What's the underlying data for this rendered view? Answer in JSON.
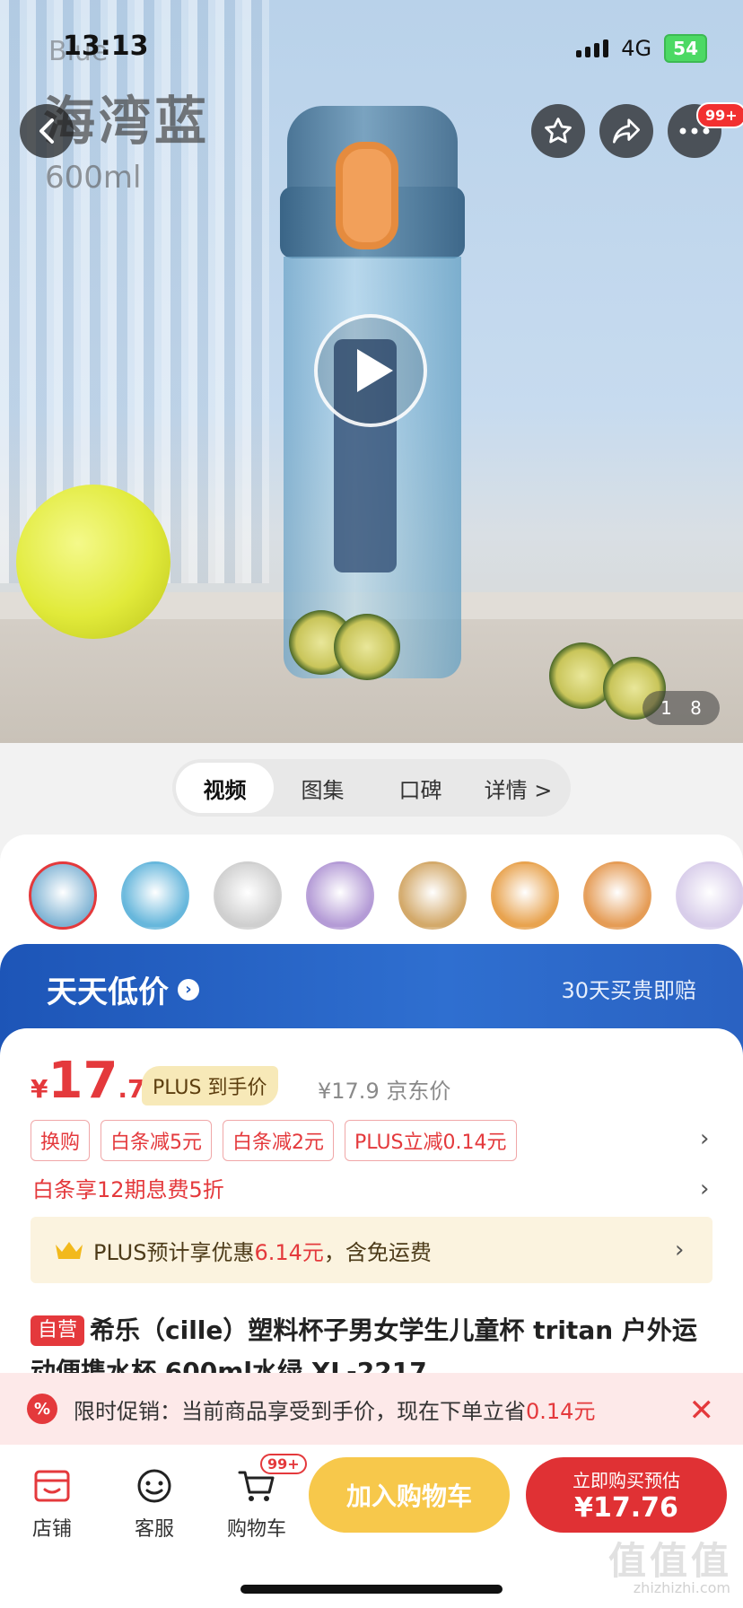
{
  "status_bar": {
    "time": "13:13",
    "network": "4G",
    "battery": "54"
  },
  "hero": {
    "overlay_title": "海湾蓝",
    "overlay_sub": "600ml",
    "overlay_top": "Blue",
    "pager_current": "1",
    "pager_total": "8",
    "cart_badge_top": "99+"
  },
  "tabs": [
    {
      "label": "视频",
      "active": true
    },
    {
      "label": "图集",
      "active": false
    },
    {
      "label": "口碑",
      "active": false
    },
    {
      "label": "详情 >",
      "active": false
    }
  ],
  "thumb_colors": [
    "#7fb3d4",
    "#67b7dc",
    "#cfcfcf",
    "#b49bd6",
    "#d3a96a",
    "#e8a34f",
    "#e59c56",
    "#d8cdea"
  ],
  "banner": {
    "title": "天天低价",
    "right": "30天买贵即赔"
  },
  "price": {
    "currency": "¥",
    "integer": "17",
    "decimal": ".76",
    "plus_tag": "PLUS 到手价",
    "jd_price": "¥17.9 京东价"
  },
  "promos": [
    "换购",
    "白条减5元",
    "白条减2元",
    "PLUS立减0.14元"
  ],
  "installment": "白条享12期息费5折",
  "plus_bar": {
    "prefix": "PLUS预计享优惠",
    "amount": "6.14元",
    "suffix": "，含免运费"
  },
  "product": {
    "tag": "自营",
    "title": "希乐（cille）塑料杯子男女学生儿童杯 tritan 户外运动便携水杯 600ml水绿 XL-2217"
  },
  "toast": {
    "text": "限时促销：当前商品享受到手价，现在下单立省",
    "amount": "0.14元",
    "icon": "%"
  },
  "bottom": {
    "store": "店铺",
    "service": "客服",
    "cart": "购物车",
    "cart_badge": "99+",
    "add_cart": "加入购物车",
    "buy_line1": "立即购买预估",
    "buy_line2": "¥17.76"
  },
  "watermark": {
    "main": "值值值",
    "sub": "zhizhizhi.com"
  },
  "colors": {
    "accent": "#e4393c",
    "banner_blue": "#1f5bbd",
    "gold": "#f7c84b"
  }
}
